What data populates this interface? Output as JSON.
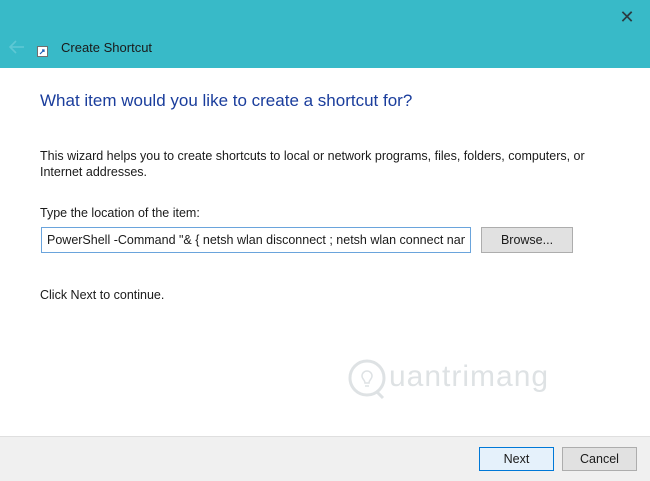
{
  "window": {
    "title": "Create Shortcut",
    "close_glyph": "✕"
  },
  "icons": {
    "close": "close-icon",
    "back": "back-arrow-icon",
    "app": "shortcut-icon",
    "watermark": "lightbulb-icon"
  },
  "colors": {
    "titlebar": "#38bac8",
    "heading": "#1a3d9c",
    "input_border": "#6aa4dc",
    "primary_button_border": "#0078d7"
  },
  "wizard": {
    "heading": "What item would you like to create a shortcut for?",
    "description": "This wizard helps you to create shortcuts to local or network programs, files, folders, computers, or Internet addresses.",
    "location_label": "Type the location of the item:",
    "location_value": "PowerShell -Command \"& { netsh wlan disconnect ; netsh wlan connect name=",
    "browse_label": "Browse...",
    "continue_text": "Click Next to continue."
  },
  "watermark": {
    "text": "uantrimang"
  },
  "footer": {
    "next_label": "Next",
    "cancel_label": "Cancel"
  }
}
